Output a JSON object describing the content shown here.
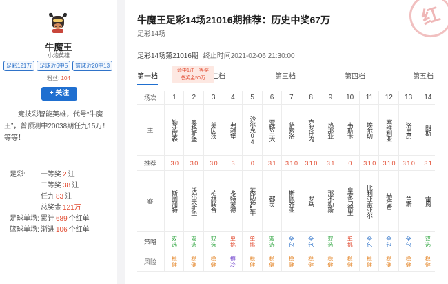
{
  "expert": {
    "name": "牛魔王",
    "subname": "小炮英雄",
    "tags": [
      "足彩121万",
      "足球近6中5",
      "篮球近20中13"
    ],
    "fans_label": "粉丝:",
    "fans_count": "104",
    "follow_label": "+ 关注",
    "bio": "竞技彩智能英雄，代号“牛魔王”，曾预测中20038期任九15万！等等！",
    "stats": [
      {
        "key": "足彩:",
        "prefix": "一等奖",
        "value": "2",
        "suffix": "注"
      },
      {
        "key": "",
        "prefix": "二等奖",
        "value": "38",
        "suffix": "注"
      },
      {
        "key": "",
        "prefix": "任九",
        "value": "83",
        "suffix": "注"
      },
      {
        "key": "",
        "prefix": "总奖金",
        "value": "121万",
        "suffix": ""
      },
      {
        "key": "足球单场:",
        "prefix": "累计",
        "value": "689",
        "suffix": "个红单"
      },
      {
        "key": "篮球单场:",
        "prefix": "渐进",
        "value": "106",
        "suffix": "个红单"
      }
    ]
  },
  "article": {
    "title": "牛魔王足彩14场21016期推荐：历史中奖67万",
    "subtitle": "足彩14场",
    "issue": "足彩14场第21016期",
    "deadline": "终止时间2021-02-06 21:30:00",
    "stamp": "红"
  },
  "tabs": {
    "items": [
      "第一档",
      "第二档",
      "第三档",
      "第四档",
      "第五档"
    ],
    "tip_line1": "命中1注一等奖",
    "tip_line2": "总奖金50万"
  },
  "table": {
    "labels": {
      "index": "场次",
      "home": "主",
      "rec": "推荐",
      "away": "客",
      "strategy": "策略",
      "risk": "风险"
    },
    "matches": [
      {
        "n": "1",
        "home": "勒沃库森",
        "rec": "3 0",
        "away": "斯图加特",
        "strategy": "双选",
        "sc": "green",
        "risk": "稳健",
        "rc": "orange"
      },
      {
        "n": "2",
        "home": "奥格斯堡",
        "rec": "3 0",
        "away": "沃尔夫斯堡",
        "strategy": "双选",
        "sc": "green",
        "risk": "稳健",
        "rc": "orange"
      },
      {
        "n": "3",
        "home": "美因茨",
        "rec": "3 0",
        "away": "柏林联合",
        "strategy": "双选",
        "sc": "green",
        "risk": "稳健",
        "rc": "orange"
      },
      {
        "n": "4",
        "home": "弗赖堡",
        "rec": "3",
        "away": "多特蒙德",
        "strategy": "单挑",
        "sc": "redc",
        "risk": "搏冷",
        "rc": "purple"
      },
      {
        "n": "5",
        "home": "沙尔克04",
        "rec": "0",
        "away": "莱比锡红牛",
        "strategy": "单挑",
        "sc": "redc",
        "risk": "稳健",
        "rc": "orange"
      },
      {
        "n": "6",
        "home": "亚特兰大",
        "rec": "3 1",
        "away": "都灵",
        "strategy": "双选",
        "sc": "green",
        "risk": "稳健",
        "rc": "orange"
      },
      {
        "n": "7",
        "home": "萨索洛",
        "rec": "3 1 0",
        "away": "斯佩齐亚",
        "strategy": "全包",
        "sc": "blue",
        "risk": "稳健",
        "rc": "orange"
      },
      {
        "n": "8",
        "home": "克罗托内",
        "rec": "3 1 0",
        "away": "罗马",
        "strategy": "全包",
        "sc": "blue",
        "risk": "稳健",
        "rc": "orange"
      },
      {
        "n": "9",
        "home": "热那亚",
        "rec": "3 1",
        "away": "那不勒斯",
        "strategy": "双选",
        "sc": "green",
        "risk": "稳健",
        "rc": "orange"
      },
      {
        "n": "10",
        "home": "韦斯卡",
        "rec": "0",
        "away": "皇家马德里",
        "strategy": "单挑",
        "sc": "redc",
        "risk": "稳健",
        "rc": "orange"
      },
      {
        "n": "11",
        "home": "埃尔切",
        "rec": "3 1 0",
        "away": "比利亚雷亚尔",
        "strategy": "全包",
        "sc": "blue",
        "risk": "稳健",
        "rc": "orange"
      },
      {
        "n": "12",
        "home": "塞维利亚",
        "rec": "3 1 0",
        "away": "赫塔费",
        "strategy": "全包",
        "sc": "blue",
        "risk": "稳健",
        "rc": "orange"
      },
      {
        "n": "13",
        "home": "洛里昂",
        "rec": "3 1 0",
        "away": "兰斯",
        "strategy": "全包",
        "sc": "blue",
        "risk": "稳健",
        "rc": "orange"
      },
      {
        "n": "14",
        "home": "朗斯",
        "rec": "3 1",
        "away": "雷恩",
        "strategy": "双选",
        "sc": "green",
        "risk": "稳健",
        "rc": "orange"
      }
    ]
  }
}
